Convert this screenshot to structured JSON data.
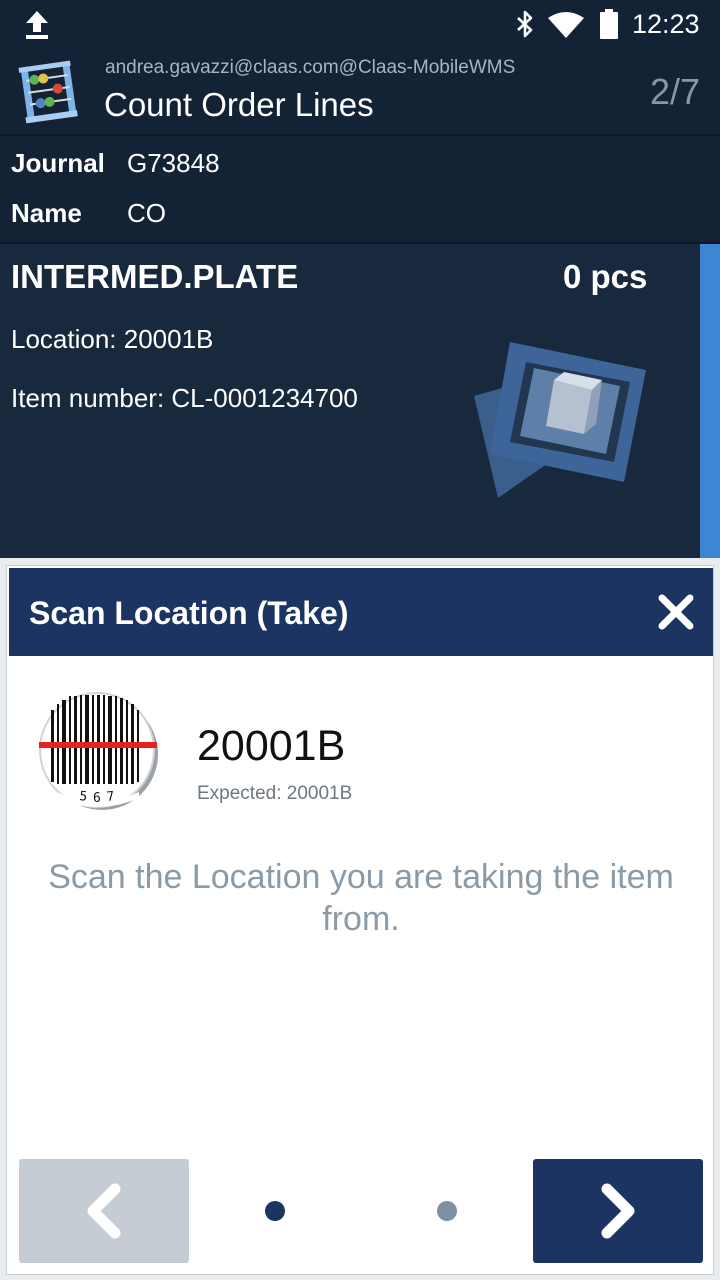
{
  "status_bar": {
    "time": "12:23",
    "icons": [
      "upload-icon",
      "bluetooth-icon",
      "wifi-icon",
      "battery-icon"
    ]
  },
  "header": {
    "user": "andrea.gavazzi@claas.com@Claas-MobileWMS",
    "title": "Count Order Lines",
    "counter": "2/7",
    "logo_icon": "abacus-icon"
  },
  "journal": {
    "journal_label": "Journal",
    "journal_value": "G73848",
    "name_label": "Name",
    "name_value": "CO"
  },
  "order_line": {
    "item_name": "INTERMED.PLATE",
    "quantity": "0 pcs",
    "location": "Location: 20001B",
    "item_number": "Item number: CL-0001234700",
    "image_icon": "item-box-icon"
  },
  "dialog": {
    "title": "Scan Location (Take)",
    "close_icon": "close-icon",
    "barcode_icon": "barcode-scan-icon",
    "scanned_value": "20001B",
    "expected": "Expected: 20001B",
    "instruction": "Scan the Location you are taking the item from.",
    "prev_icon": "chevron-left-icon",
    "next_icon": "chevron-right-icon",
    "page_dots": 2,
    "active_dot": 1
  },
  "colors": {
    "header_bg": "#132234",
    "card_bg": "#18293d",
    "accent": "#3c86d4",
    "dialog_header": "#1c3461",
    "instruction_text": "#8a9aa6"
  }
}
